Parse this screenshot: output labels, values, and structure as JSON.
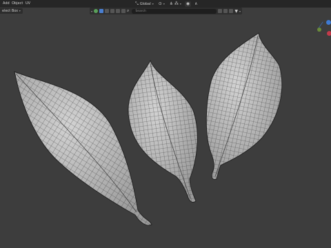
{
  "menu": {
    "add": "Add",
    "object": "Object",
    "uv": "UV"
  },
  "center_tools": {
    "transform_label": "Global"
  },
  "select_mode": {
    "label": "elect Box"
  },
  "outliner_header": {
    "search_placeholder": "Search"
  },
  "colors": {
    "background": "#3d3d3d",
    "leaf_fill": "#bdbdbd",
    "mesh_lines": "#2a2a2a",
    "axis_x": "#c33a4a",
    "axis_y": "#6a8a3a",
    "axis_z": "#3e7ad3"
  },
  "icons": [
    "filter-icon",
    "magnet-icon",
    "pivot-icon",
    "proportional-icon"
  ]
}
